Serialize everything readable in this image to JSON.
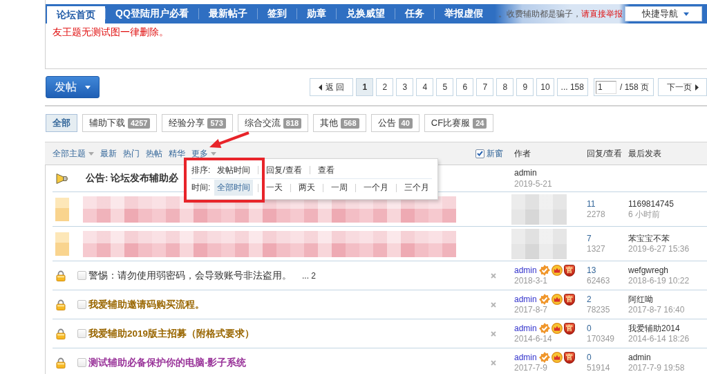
{
  "nav": {
    "tabs": [
      {
        "label": "论坛首页",
        "selected": true
      },
      {
        "label": "QQ登陆用户必看",
        "selected": false
      },
      {
        "label": "最新帖子",
        "selected": false
      },
      {
        "label": "签到",
        "selected": false
      },
      {
        "label": "勋章",
        "selected": false
      },
      {
        "label": "兑换威望",
        "selected": false
      },
      {
        "label": "任务",
        "selected": false
      },
      {
        "label": "举报虚假",
        "selected": false
      }
    ],
    "quick_nav": "快捷导航"
  },
  "notice": {
    "line_1": [
      {
        "text": "。收费辅助都是骗子，",
        "kind": "plain"
      },
      {
        "text": "请直接举报",
        "kind": "alert"
      }
    ],
    "line_2": [
      {
        "text": "友王题无测试图一律删除。",
        "kind": "alert"
      }
    ]
  },
  "toolbar": {
    "post_button": "发帖",
    "pager": {
      "back": "返 回",
      "pages": [
        {
          "label": "1",
          "selected": true
        },
        {
          "label": "2",
          "selected": false
        },
        {
          "label": "3",
          "selected": false
        },
        {
          "label": "4",
          "selected": false
        },
        {
          "label": "5",
          "selected": false
        },
        {
          "label": "6",
          "selected": false
        },
        {
          "label": "7",
          "selected": false
        },
        {
          "label": "8",
          "selected": false
        },
        {
          "label": "9",
          "selected": false
        },
        {
          "label": "10",
          "selected": false
        }
      ],
      "last": "... 158",
      "page_input": "1",
      "total": "/ 158 页",
      "next": "下一页"
    }
  },
  "categories": [
    {
      "label": "全部",
      "selected": true
    },
    {
      "label": "辅助下载",
      "count": "4257",
      "selected": false
    },
    {
      "label": "经验分享",
      "count": "573",
      "selected": false
    },
    {
      "label": "综合交流",
      "count": "818",
      "selected": false
    },
    {
      "label": "其他",
      "count": "568",
      "selected": false
    },
    {
      "label": "公告",
      "count": "40",
      "selected": false
    },
    {
      "label": "CF比赛服",
      "count": "24",
      "selected": false
    }
  ],
  "list_header": {
    "filters": [
      {
        "label": "全部主题",
        "kind": "dropdown"
      },
      {
        "label": "最新",
        "kind": "link"
      },
      {
        "label": "热门",
        "kind": "link"
      },
      {
        "label": "热帖",
        "kind": "link"
      },
      {
        "label": "精华",
        "kind": "link"
      },
      {
        "label": "更多",
        "kind": "dropdown"
      }
    ],
    "new_window": {
      "label": "新窗",
      "checked": true
    },
    "columns": [
      "作者",
      "回复/查看",
      "最后发表"
    ]
  },
  "sort_menu": {
    "rows": [
      {
        "label": "排序:",
        "options": [
          {
            "label": "发帖时间",
            "selected": false
          },
          {
            "label": "回复/查看",
            "selected": false
          },
          {
            "label": "查看",
            "selected": false
          }
        ]
      },
      {
        "label": "时间:",
        "options": [
          {
            "label": "全部时间",
            "selected": true
          },
          {
            "label": "一天",
            "selected": false
          },
          {
            "label": "两天",
            "selected": false
          },
          {
            "label": "一周",
            "selected": false
          },
          {
            "label": "一个月",
            "selected": false
          },
          {
            "label": "三个月",
            "selected": false
          }
        ]
      }
    ]
  },
  "threads": [
    {
      "kind": "announcement",
      "title": "公告: 论坛发布辅助必",
      "bold": true,
      "color": "#333333",
      "author": {
        "name": "admin",
        "date": "2019-5-21",
        "color": "#333333"
      }
    },
    {
      "kind": "blurred",
      "replies": "11",
      "views": "2278",
      "last_poster": "1169814745",
      "last_time": "6 小时前"
    },
    {
      "kind": "blurred",
      "replies": "7",
      "views": "1327",
      "last_poster": "苯宝宝不苯",
      "last_time": "2019-6-27 15:36"
    },
    {
      "kind": "locked",
      "checked": false,
      "title": "警惕：请勿使用弱密码，会导致账号非法盗用。",
      "bold": false,
      "color": "#333333",
      "pages": "... 2",
      "author": {
        "name": "admin",
        "date": "2018-3-1",
        "color": "#3333cc"
      },
      "badges": [
        {
          "kind": "verified"
        },
        {
          "kind": "crown"
        },
        {
          "kind": "official",
          "label": "官"
        }
      ],
      "replies": "13",
      "views": "62463",
      "last_poster": "wefgwregh",
      "last_time": "2018-6-19 10:22"
    },
    {
      "kind": "locked",
      "checked": false,
      "title": "我爱辅助邀请码购买流程。",
      "bold": true,
      "color": "#996600",
      "author": {
        "name": "admin",
        "date": "2017-8-7",
        "color": "#3333cc"
      },
      "badges": [
        {
          "kind": "verified"
        },
        {
          "kind": "crown"
        },
        {
          "kind": "official",
          "label": "官"
        }
      ],
      "replies": "2",
      "views": "78235",
      "last_poster": "阿红呦",
      "last_time": "2017-8-7 16:40"
    },
    {
      "kind": "locked",
      "checked": false,
      "title": "我爱辅助2019版主招募（附格式要求）",
      "bold": true,
      "color": "#996600",
      "author": {
        "name": "admin",
        "date": "2014-6-14",
        "color": "#3333cc"
      },
      "badges": [
        {
          "kind": "verified"
        },
        {
          "kind": "crown"
        },
        {
          "kind": "official",
          "label": "官"
        }
      ],
      "replies": "0",
      "views": "170349",
      "last_poster": "我爱辅助2014",
      "last_time": "2014-6-14 18:26"
    },
    {
      "kind": "locked",
      "checked": false,
      "title": "测试辅助必备保护你的电脑-影子系统",
      "bold": true,
      "color": "#993399",
      "author": {
        "name": "admin",
        "date": "2017-7-9",
        "color": "#3333cc"
      },
      "badges": [
        {
          "kind": "verified"
        },
        {
          "kind": "crown"
        },
        {
          "kind": "official",
          "label": "官"
        }
      ],
      "replies": "0",
      "views": "51914",
      "last_poster": "admin",
      "last_time": "2017-7-9 19:58"
    }
  ]
}
